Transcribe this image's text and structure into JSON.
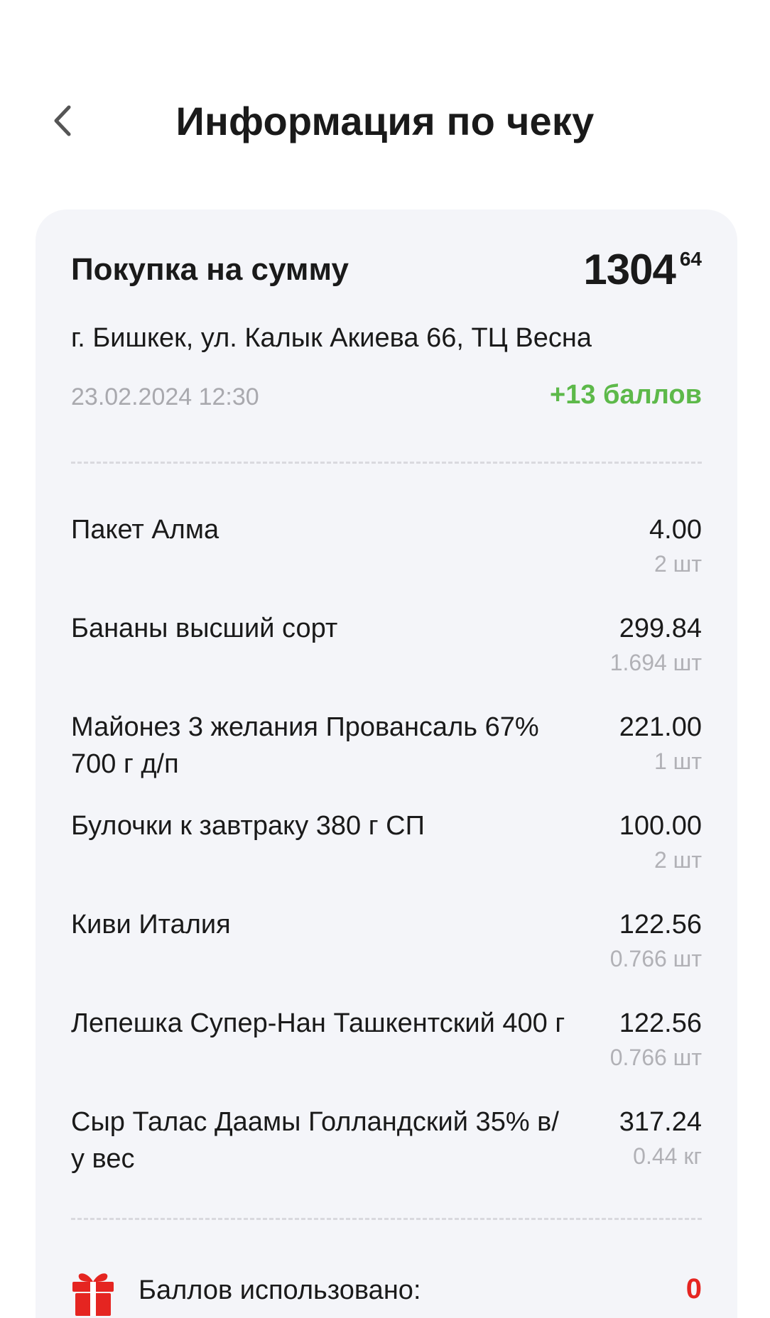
{
  "header": {
    "title": "Информация по чеку"
  },
  "receipt": {
    "purchase_label": "Покупка на сумму",
    "total_int": "1304",
    "total_frac": "64",
    "address": "г. Бишкек, ул. Калык Акиева 66, ТЦ Весна",
    "datetime": "23.02.2024 12:30",
    "points_earned": "+13 баллов"
  },
  "items": [
    {
      "name": "Пакет Алма",
      "price": "4.00",
      "qty": "2 шт"
    },
    {
      "name": "Бананы высший сорт",
      "price": "299.84",
      "qty": "1.694 шт"
    },
    {
      "name": "Майонез 3 желания Провансаль 67% 700 г д/п",
      "price": "221.00",
      "qty": "1 шт"
    },
    {
      "name": "Булочки к завтраку 380 г СП",
      "price": "100.00",
      "qty": "2 шт"
    },
    {
      "name": "Киви Италия",
      "price": "122.56",
      "qty": "0.766 шт"
    },
    {
      "name": "Лепешка Супер-Нан Ташкентский 400 г",
      "price": "122.56",
      "qty": "0.766 шт"
    },
    {
      "name": "Сыр Талас Даамы Голландский 35% в/у вес",
      "price": "317.24",
      "qty": "0.44 кг"
    }
  ],
  "points_used": {
    "label": "Баллов использовано:",
    "value": "0",
    "icon": "gift-icon"
  },
  "colors": {
    "card_bg": "#f4f5f9",
    "points_green": "#5db94a",
    "points_red": "#e52521",
    "muted_gray": "#a9a9ae"
  }
}
